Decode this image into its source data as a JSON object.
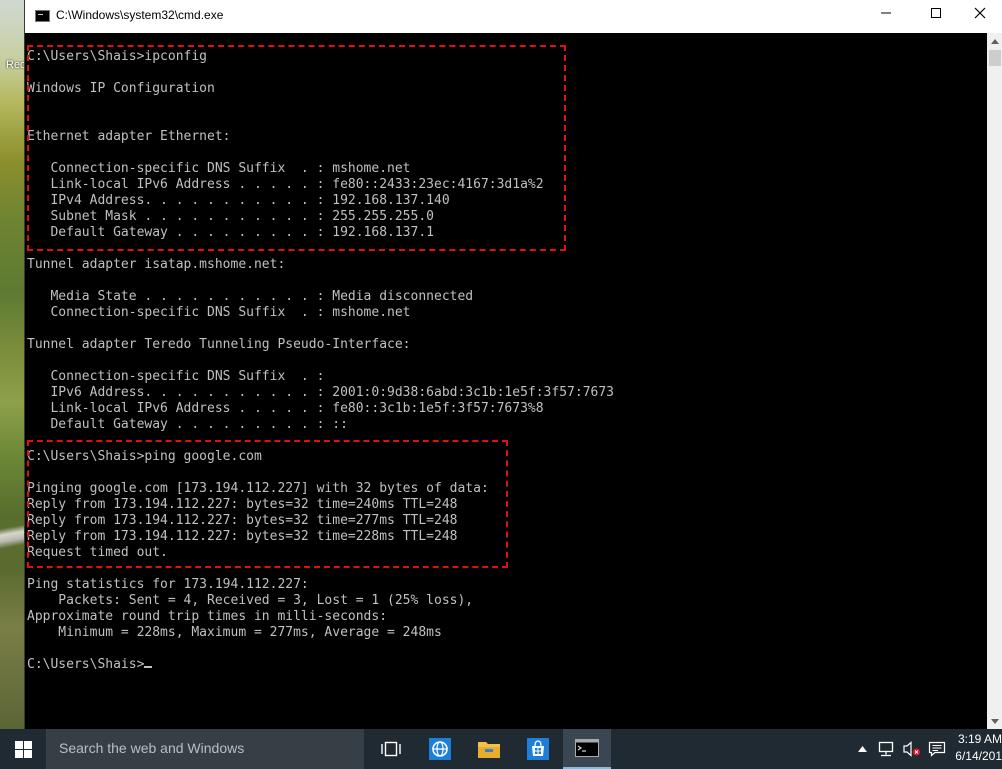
{
  "desktop": {
    "icon_label": "Rec"
  },
  "window": {
    "title": "C:\\Windows\\system32\\cmd.exe",
    "controls": {
      "minimize": "minimize",
      "maximize": "maximize",
      "close": "close"
    }
  },
  "console": {
    "text": "C:\\Users\\Shais>ipconfig\n\nWindows IP Configuration\n\n\nEthernet adapter Ethernet:\n\n   Connection-specific DNS Suffix  . : mshome.net\n   Link-local IPv6 Address . . . . . : fe80::2433:23ec:4167:3d1a%2\n   IPv4 Address. . . . . . . . . . . : 192.168.137.140\n   Subnet Mask . . . . . . . . . . . : 255.255.255.0\n   Default Gateway . . . . . . . . . : 192.168.137.1\n\nTunnel adapter isatap.mshome.net:\n\n   Media State . . . . . . . . . . . : Media disconnected\n   Connection-specific DNS Suffix  . : mshome.net\n\nTunnel adapter Teredo Tunneling Pseudo-Interface:\n\n   Connection-specific DNS Suffix  . :\n   IPv6 Address. . . . . . . . . . . : 2001:0:9d38:6abd:3c1b:1e5f:3f57:7673\n   Link-local IPv6 Address . . . . . : fe80::3c1b:1e5f:3f57:7673%8\n   Default Gateway . . . . . . . . . : ::\n\nC:\\Users\\Shais>ping google.com\n\nPinging google.com [173.194.112.227] with 32 bytes of data:\nReply from 173.194.112.227: bytes=32 time=240ms TTL=248\nReply from 173.194.112.227: bytes=32 time=277ms TTL=248\nReply from 173.194.112.227: bytes=32 time=228ms TTL=248\nRequest timed out.\n\nPing statistics for 173.194.112.227:\n    Packets: Sent = 4, Received = 3, Lost = 1 (25% loss),\nApproximate round trip times in milli-seconds:\n    Minimum = 228ms, Maximum = 277ms, Average = 248ms\n\nC:\\Users\\Shais>",
    "colors": {
      "background": "#000000",
      "foreground": "#c0c0c0",
      "highlight_border": "#e01010"
    }
  },
  "taskbar": {
    "search_placeholder": "Search the web and Windows",
    "pinned": [
      "start-icon",
      "task-view-icon",
      "internet-explorer-icon",
      "file-explorer-icon",
      "store-icon",
      "command-prompt-icon"
    ],
    "active_app": "command-prompt-icon",
    "tray": [
      "show-hidden-icons-chevron",
      "network-icon",
      "volume-muted-icon",
      "action-center-icon"
    ],
    "clock": {
      "time": "3:19 AM",
      "date": "6/14/201"
    }
  }
}
